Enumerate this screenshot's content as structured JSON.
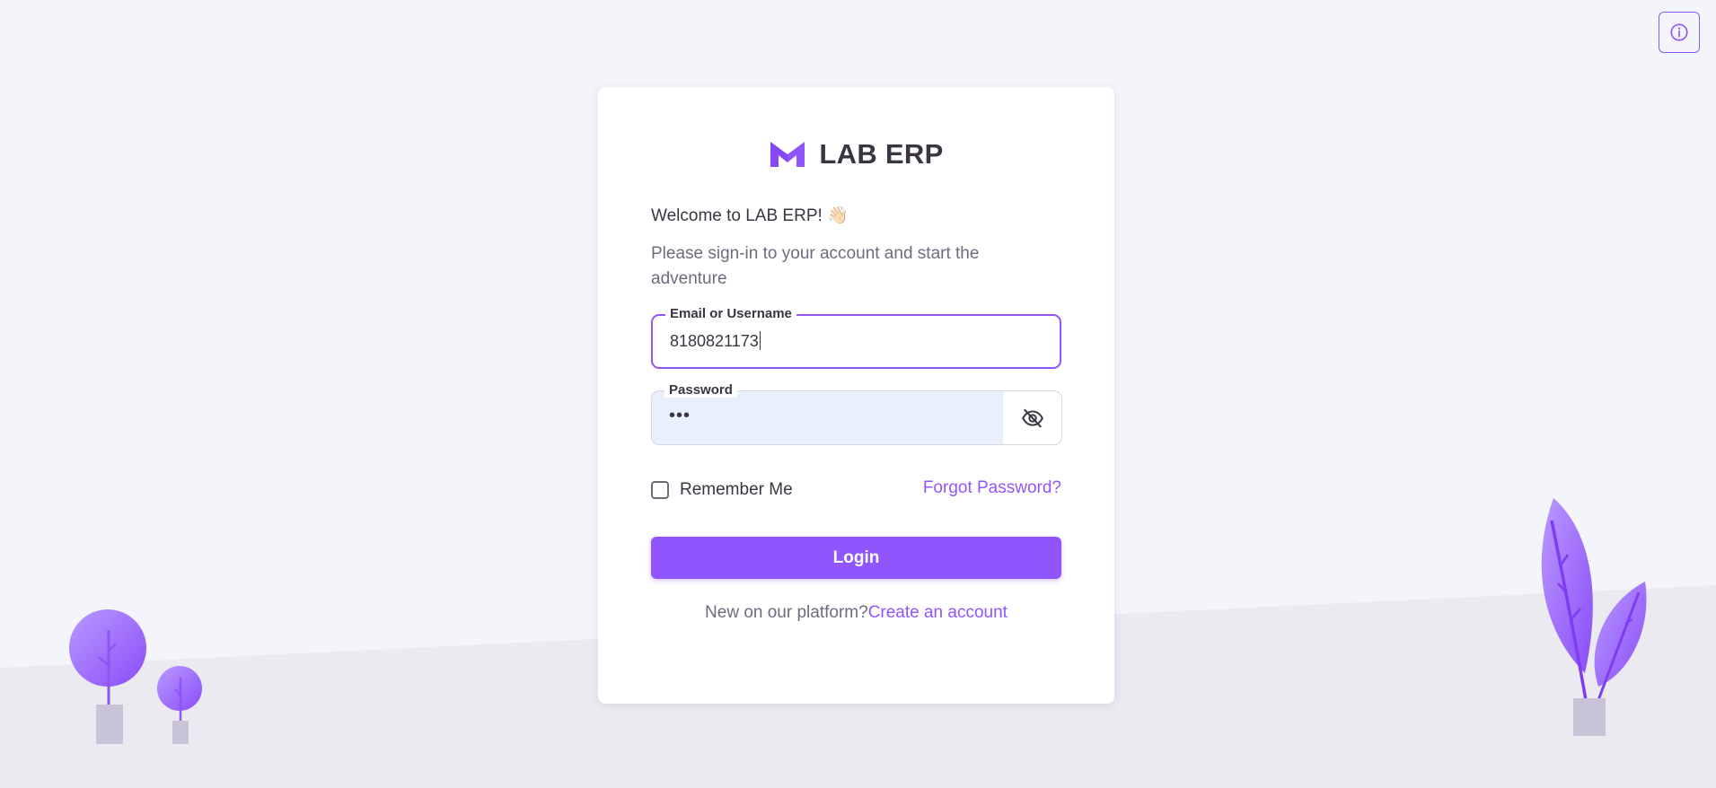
{
  "app": {
    "brand_title": "LAB ERP",
    "welcome": "Welcome to LAB ERP! 👋🏻",
    "subtitle": "Please sign-in to your account and start the adventure"
  },
  "form": {
    "email_label": "Email or Username",
    "email_value": "8180821173",
    "password_label": "Password",
    "password_masked": "•••",
    "remember_label": "Remember Me",
    "remember_checked": false,
    "forgot_label": "Forgot Password?",
    "login_label": "Login",
    "signup_question": "New on our platform?",
    "signup_link": "Create an account"
  },
  "icons": {
    "info": "info-icon",
    "logo": "m-logo-icon",
    "eye_off": "eye-off-icon"
  },
  "colors": {
    "primary": "#9155fd",
    "background": "#f4f5fa",
    "card": "#ffffff",
    "text": "#3a3541",
    "muted_text": "#6f6b7d",
    "autofill": "#e8f0fe"
  }
}
